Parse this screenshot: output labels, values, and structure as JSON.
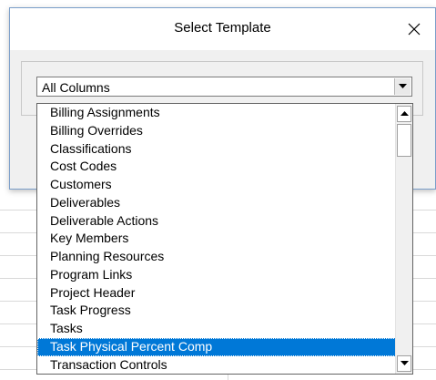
{
  "dialog": {
    "title": "Select Template",
    "close_icon": "close-x-icon"
  },
  "combo": {
    "selected_value": "All Columns",
    "arrow_icon": "chevron-down-icon"
  },
  "dropdown": {
    "items": [
      {
        "label": "Billing Assignments"
      },
      {
        "label": "Billing Overrides"
      },
      {
        "label": "Classifications"
      },
      {
        "label": "Cost Codes"
      },
      {
        "label": "Customers"
      },
      {
        "label": "Deliverables"
      },
      {
        "label": "Deliverable Actions"
      },
      {
        "label": "Key Members"
      },
      {
        "label": "Planning Resources"
      },
      {
        "label": "Program Links"
      },
      {
        "label": "Project Header"
      },
      {
        "label": "Task Progress"
      },
      {
        "label": "Tasks"
      },
      {
        "label": "Task Physical Percent Comp"
      },
      {
        "label": "Transaction Controls"
      }
    ],
    "highlighted_item": "Task Physical Percent Comp",
    "highlight_color": "#0078d7",
    "scroll_up_icon": "scroll-up-arrow-icon",
    "scroll_down_icon": "scroll-down-arrow-icon"
  }
}
